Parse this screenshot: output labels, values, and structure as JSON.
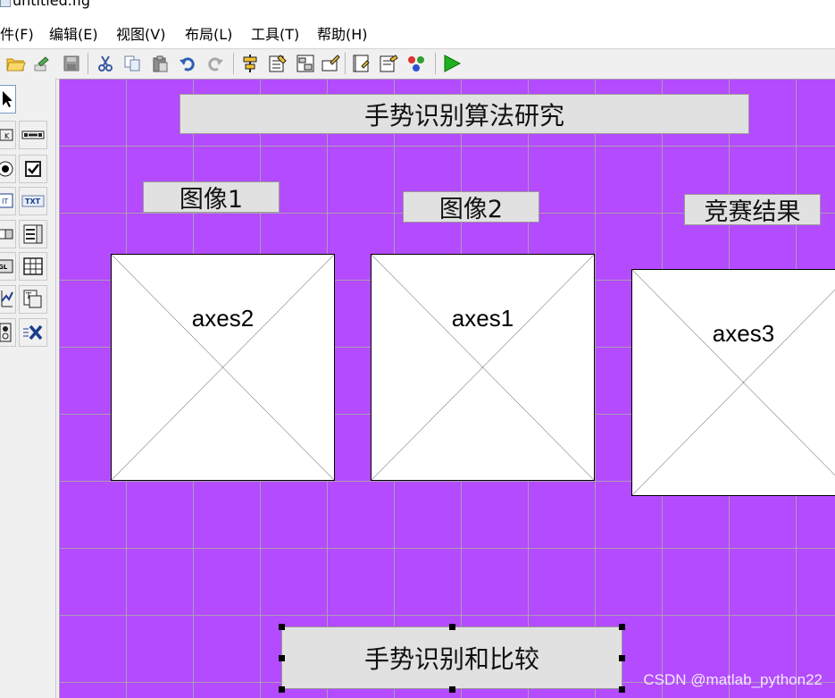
{
  "window": {
    "title": "untitled.fig"
  },
  "menu": [
    {
      "label": "件(F)"
    },
    {
      "label": "编辑(E)"
    },
    {
      "label": "视图(V)"
    },
    {
      "label": "布局(L)"
    },
    {
      "label": "工具(T)"
    },
    {
      "label": "帮助(H)"
    }
  ],
  "toolbar": [
    {
      "icon": "open-folder-icon"
    },
    {
      "icon": "export-icon"
    },
    {
      "icon": "save-icon"
    },
    {
      "icon": "cut-icon"
    },
    {
      "icon": "copy-icon"
    },
    {
      "icon": "paste-icon"
    },
    {
      "icon": "undo-icon"
    },
    {
      "icon": "redo-icon"
    },
    {
      "icon": "align-objects-icon"
    },
    {
      "icon": "menu-editor-icon"
    },
    {
      "icon": "tab-order-editor-icon"
    },
    {
      "icon": "toolbar-editor-icon"
    },
    {
      "icon": "editor-icon"
    },
    {
      "icon": "property-inspector-icon"
    },
    {
      "icon": "object-browser-icon"
    },
    {
      "icon": "run-icon"
    }
  ],
  "palette": [
    {
      "icon": "select-arrow-icon"
    },
    {
      "icon": "push-button-icon"
    },
    {
      "icon": "slider-icon"
    },
    {
      "icon": "radio-button-icon"
    },
    {
      "icon": "checkbox-icon"
    },
    {
      "icon": "edit-text-icon",
      "text": "EDIT"
    },
    {
      "icon": "static-text-icon",
      "text": "TXT"
    },
    {
      "icon": "popup-menu-icon"
    },
    {
      "icon": "listbox-icon"
    },
    {
      "icon": "toggle-button-icon",
      "text": "TGL"
    },
    {
      "icon": "table-icon"
    },
    {
      "icon": "axes-icon"
    },
    {
      "icon": "panel-icon"
    },
    {
      "icon": "button-group-icon"
    },
    {
      "icon": "activex-icon"
    }
  ],
  "canvas": {
    "background": "#b44bff",
    "title_label": "手势识别算法研究",
    "label1": "图像1",
    "label2": "图像2",
    "label3": "竞赛结果",
    "axes": [
      {
        "name": "axes2"
      },
      {
        "name": "axes1"
      },
      {
        "name": "axes3"
      }
    ],
    "button_label": "手势识别和比较"
  },
  "watermark": "CSDN @matlab_python22"
}
